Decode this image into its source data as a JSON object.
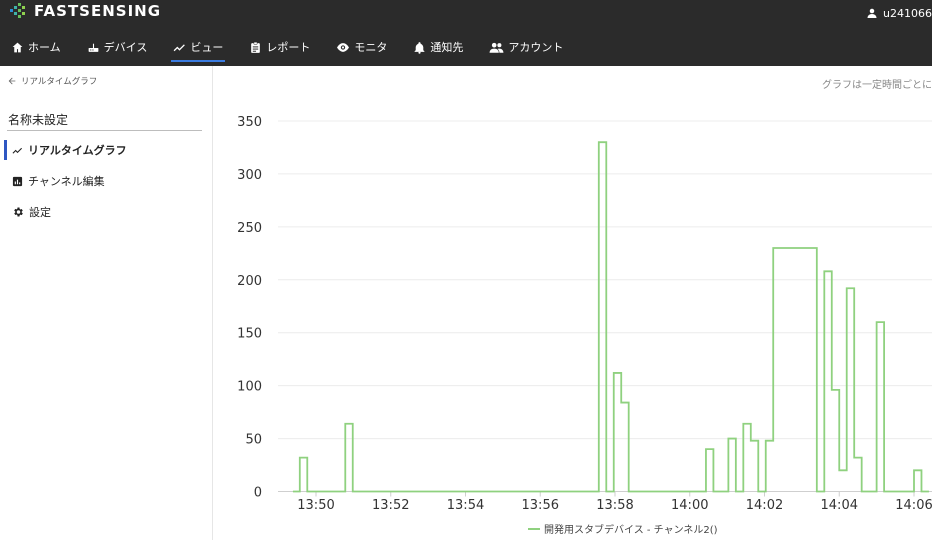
{
  "brand": {
    "name_part1": "FAST",
    "name_part2": "SENSING"
  },
  "user": {
    "name": "u241066"
  },
  "nav": {
    "items": [
      {
        "label": "ホーム",
        "icon": "home-icon"
      },
      {
        "label": "デバイス",
        "icon": "router-icon"
      },
      {
        "label": "ビュー",
        "icon": "trending-icon",
        "active": true
      },
      {
        "label": "レポート",
        "icon": "clipboard-icon"
      },
      {
        "label": "モニタ",
        "icon": "eye-icon"
      },
      {
        "label": "通知先",
        "icon": "bell-icon"
      },
      {
        "label": "アカウント",
        "icon": "people-icon"
      }
    ]
  },
  "sidebar": {
    "back_label": "リアルタイムグラフ",
    "title": "名称未設定",
    "items": [
      {
        "label": "リアルタイムグラフ",
        "icon": "trending-icon",
        "active": true
      },
      {
        "label": "チャンネル編集",
        "icon": "bar-chart-icon"
      },
      {
        "label": "設定",
        "icon": "gear-icon"
      }
    ]
  },
  "main": {
    "note": "グラフは一定時間ごとに"
  },
  "colors": {
    "topbar": "#2b2b2b",
    "accent": "#3a7be0",
    "line": "#8fd17f",
    "active_bar": "#2f57c2"
  },
  "chart_data": {
    "type": "line",
    "step": true,
    "xlabel": "",
    "ylabel": "",
    "ylim": [
      0,
      350
    ],
    "yticks": [
      0,
      50,
      100,
      150,
      200,
      250,
      300,
      350
    ],
    "xticks": [
      "13:50",
      "13:52",
      "13:54",
      "13:56",
      "13:58",
      "14:00",
      "14:02",
      "14:04",
      "14:06"
    ],
    "grid": true,
    "legend_position": "bottom-center",
    "series": [
      {
        "name": "開発用スタブデバイス - チャンネル2()",
        "color": "#8fd17f",
        "x": [
          "13:49:23",
          "13:49:34",
          "13:49:46",
          "13:50:47",
          "13:50:59",
          "13:51:10",
          "13:57:22",
          "13:57:34",
          "13:57:46",
          "13:57:58",
          "13:58:10",
          "13:58:22",
          "13:58:34",
          "14:00:14",
          "14:00:26",
          "14:00:38",
          "14:00:50",
          "14:01:02",
          "14:01:14",
          "14:01:26",
          "14:01:38",
          "14:01:50",
          "14:02:02",
          "14:02:14",
          "14:03:24",
          "14:03:36",
          "14:03:48",
          "14:04:00",
          "14:04:12",
          "14:04:24",
          "14:04:36",
          "14:04:48",
          "14:05:00",
          "14:05:12",
          "14:05:24",
          "14:05:36",
          "14:05:48",
          "14:06:00",
          "14:06:12",
          "14:06:24"
        ],
        "values": [
          0,
          32,
          0,
          64,
          0,
          0,
          0,
          330,
          0,
          112,
          84,
          0,
          0,
          0,
          40,
          0,
          0,
          50,
          0,
          64,
          48,
          0,
          48,
          230,
          0,
          208,
          96,
          20,
          192,
          32,
          0,
          0,
          160,
          0,
          0,
          0,
          0,
          20,
          0,
          0
        ]
      }
    ]
  },
  "legend": {
    "label": "開発用スタブデバイス - チャンネル2()"
  }
}
